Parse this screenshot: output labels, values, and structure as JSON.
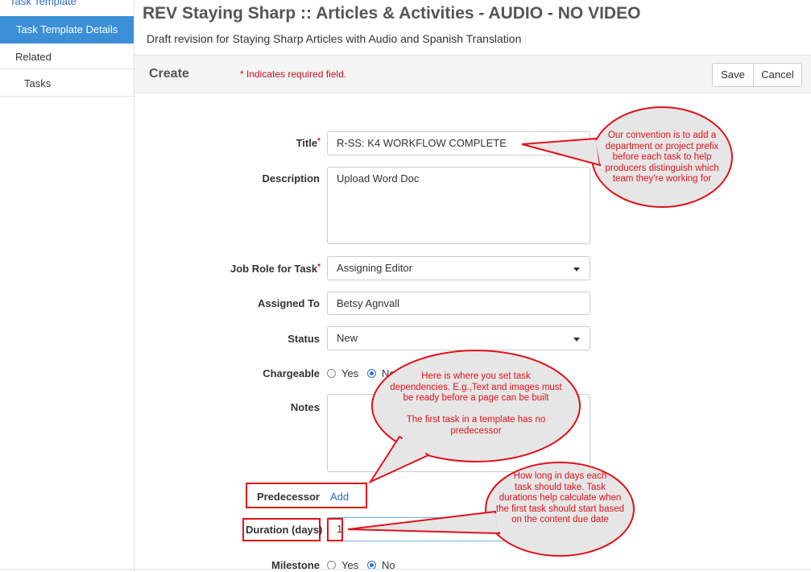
{
  "sidebar": {
    "top_link": "Task Template",
    "active_item": "Task Template Details",
    "related": "Related",
    "tasks": "Tasks"
  },
  "header": {
    "title": "REV Staying Sharp :: Articles & Activities - AUDIO - NO VIDEO",
    "subtitle": "Draft revision for Staying Sharp Articles with Audio and Spanish Translation"
  },
  "toolbar": {
    "create_label": "Create",
    "required_note": "* Indicates required field.",
    "save_label": "Save",
    "cancel_label": "Cancel"
  },
  "form": {
    "title_label": "Title",
    "title_value": "R-SS: K4 WORKFLOW COMPLETE",
    "description_label": "Description",
    "description_value": "Upload Word Doc",
    "job_role_label": "Job Role for Task",
    "job_role_value": "Assigning Editor",
    "assigned_to_label": "Assigned To",
    "assigned_to_value": "Betsy Agnvall",
    "status_label": "Status",
    "status_value": "New",
    "chargeable_label": "Chargeable",
    "chargeable_yes": "Yes",
    "chargeable_no": "No",
    "chargeable_selected": "No",
    "notes_label": "Notes",
    "predecessor_label": "Predecessor",
    "predecessor_add": "Add",
    "duration_label": "Duration (days)",
    "duration_value": "1",
    "milestone_label": "Milestone",
    "milestone_yes": "Yes",
    "milestone_no": "No",
    "milestone_selected": "No",
    "required_mark": "*"
  },
  "callouts": {
    "title_tip": [
      "Our convention is to add a",
      "department or project prefix",
      "before each task to help",
      "producers distinguish which",
      "team they're working for"
    ],
    "predecessor_tip": [
      "Here is where you set task",
      "dependencies. E.g.,Text and images must",
      "be ready before a page can be built",
      "",
      "The first task in a template has no",
      "predecessor"
    ],
    "duration_tip": [
      "How long in days each",
      "task should take. Task",
      "durations help calculate when",
      "the first task should start based",
      "on the content due date"
    ]
  },
  "colors": {
    "accent": "#3a8fd6",
    "required": "#c0111a",
    "annotation_red": "#e0121a",
    "callout_fill": "#e6e6e6"
  }
}
